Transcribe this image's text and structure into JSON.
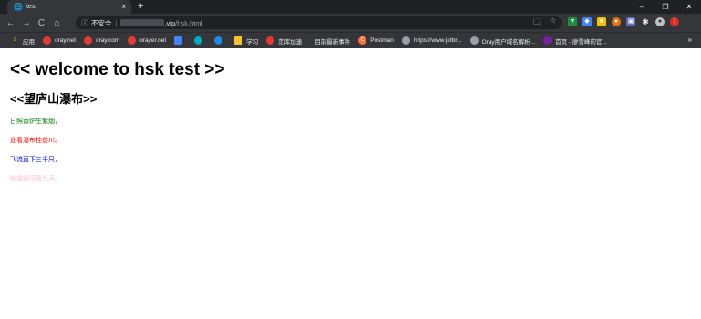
{
  "browser": {
    "tab_title": "test",
    "tab_close": "×",
    "new_tab": "+",
    "window_controls": [
      "–",
      "❐",
      "✕"
    ],
    "address": {
      "security_label": "不安全",
      "host_suffix": ".vip",
      "path": "/hsk.html"
    },
    "icons": {
      "back": "←",
      "forward": "→",
      "reload": "C",
      "home": "⌂",
      "info": "ⓘ",
      "translate": "🗔",
      "star": "☆",
      "more": "»"
    },
    "bookmarks": [
      {
        "label": "应用",
        "color": "#f9ab00"
      },
      {
        "label": "oray.net",
        "color": "#e53935"
      },
      {
        "label": "oray.com",
        "color": "#e53935"
      },
      {
        "label": "orayer.net",
        "color": "#e53935"
      },
      {
        "label": "",
        "color": "#4285f4"
      },
      {
        "label": "",
        "color": "#00acc1"
      },
      {
        "label": "",
        "color": "#1e88e5"
      },
      {
        "label": "学习",
        "color": "#fbc02d"
      },
      {
        "label": "范库加速",
        "color": "#e53935"
      },
      {
        "label": "目前最新事件",
        "color": "#35363a"
      },
      {
        "label": "Postman",
        "color": "#ff6c37"
      },
      {
        "label": "https://www.jetbr...",
        "color": "#9aa0a6"
      },
      {
        "label": "Oray用户域名解析...",
        "color": "#9aa0a6"
      },
      {
        "label": "首页 - 廖雪峰的官...",
        "color": "#7b1fa2"
      }
    ]
  },
  "page": {
    "heading": "<< welcome to hsk test >>",
    "subheading": "<<望庐山瀑布>>",
    "lines": [
      {
        "text": "日照香炉生紫烟，",
        "color": "#008000"
      },
      {
        "text": "遥看瀑布挂前川。",
        "color": "#ff0000"
      },
      {
        "text": "飞流直下三千尺，",
        "color": "#0000ff"
      },
      {
        "text": "疑是银河落九天。",
        "color": "#ffc0cb"
      }
    ]
  }
}
